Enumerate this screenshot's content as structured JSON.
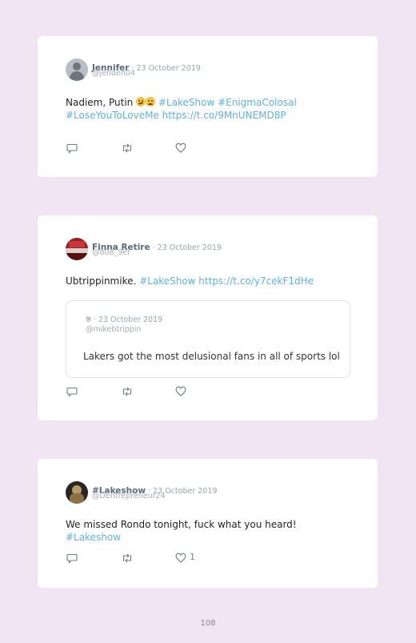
{
  "tweets": [
    {
      "name": "Jennifer",
      "sep": " · ",
      "date": "23 October 2019",
      "handle": "@jenden04",
      "text_plain": "Nadiem, Putin ",
      "emoji": [
        "thinking-face-emoji",
        "frowning-face-emoji"
      ],
      "text_link_1": "#LakeShow #EnigmaColosal",
      "text_link_2": "#LoseYouToLoveMe https://t.co/9MnUNEMD8P",
      "likes": ""
    },
    {
      "name": "Finna Retire",
      "sep": " · ",
      "date": "23 October 2019",
      "handle": "@808_9er",
      "text_plain": "Ubtrippinmike. ",
      "text_link": "#LakeShow https://t.co/y7cekF1dHe",
      "quote": {
        "name": "𝕭",
        "sep": " · ",
        "date": "23 October 2019",
        "handle": "@mikebtrippin",
        "text": "Lakers got the most delusional fans in all of sports lol"
      },
      "likes": ""
    },
    {
      "name": "#Lakeshow",
      "sep": " · ",
      "date": "23 October 2019",
      "handle": "@DEntrepreneur24",
      "text_plain": "We missed Rondo tonight, fuck what you heard! ",
      "text_link": "#Lakeshow",
      "likes": "1"
    }
  ],
  "icons": {
    "reply": "comment-icon",
    "retweet": "retweet-icon",
    "like": "heart-icon"
  },
  "colors": {
    "background": "#f1e4f3",
    "card": "#ffffff",
    "link": "#5fb2dc"
  },
  "page_number": "108"
}
